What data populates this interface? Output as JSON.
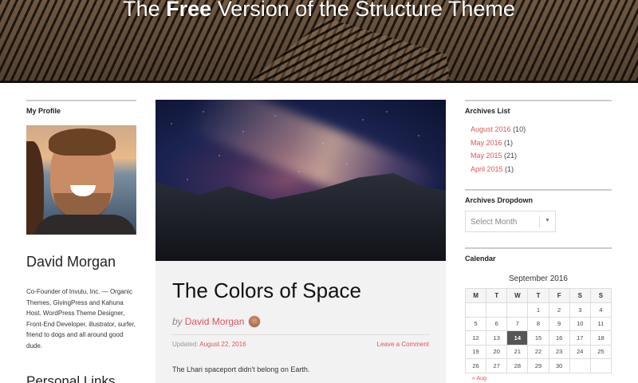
{
  "header": {
    "title_prefix": "The ",
    "title_bold": "Free",
    "title_suffix": " Version of the Structure Theme"
  },
  "left_sidebar": {
    "profile_widget_title": "My Profile",
    "name": "David Morgan",
    "bio": "Co-Founder of Invulu, Inc. — Organic Themes, GivingPress and Kahuna Host. WordPress Theme Designer, Front-End Developer, illustrator, surfer, friend to dogs and all around good dude.",
    "personal_links_title": "Personal Links"
  },
  "post": {
    "title": "The Colors of Space",
    "by": "by",
    "author": "David Morgan",
    "updated_label": "Updated:",
    "date": "August 22, 2016",
    "comment_link": "Leave a Comment",
    "excerpt": "The Lhari spaceport didn't belong on Earth."
  },
  "right_sidebar": {
    "archives_list_title": "Archives List",
    "archives": [
      {
        "label": "August 2016",
        "count": "(10)"
      },
      {
        "label": "May 2016",
        "count": "(1)"
      },
      {
        "label": "May 2015",
        "count": "(21)"
      },
      {
        "label": "April 2015",
        "count": "(1)"
      }
    ],
    "archives_dropdown_title": "Archives Dropdown",
    "select_placeholder": "Select Month",
    "calendar_title": "Calendar",
    "calendar": {
      "caption": "September 2016",
      "weekdays": [
        "M",
        "T",
        "W",
        "T",
        "F",
        "S",
        "S"
      ],
      "weeks": [
        [
          "",
          "",
          "",
          "1",
          "2",
          "3",
          "4"
        ],
        [
          "5",
          "6",
          "7",
          "8",
          "9",
          "10",
          "11"
        ],
        [
          "12",
          "13",
          "14",
          "15",
          "16",
          "17",
          "18"
        ],
        [
          "19",
          "20",
          "21",
          "22",
          "23",
          "24",
          "25"
        ],
        [
          "26",
          "27",
          "28",
          "29",
          "30",
          "",
          ""
        ]
      ],
      "today": "14",
      "prev_link": "« Aug"
    }
  },
  "colors": {
    "accent": "#e0555a"
  }
}
